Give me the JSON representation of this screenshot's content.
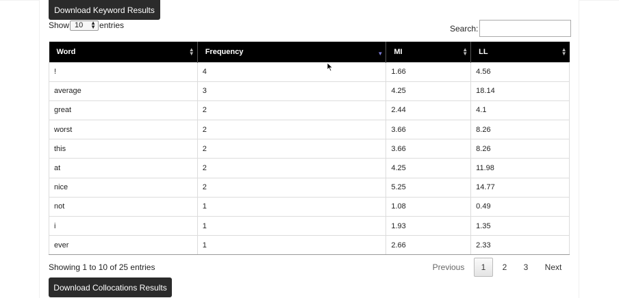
{
  "buttons": {
    "download_keyword": "Download Keyword Results",
    "download_collocations": "Download Collocations Results"
  },
  "length": {
    "show_label": "Show",
    "selected": "10",
    "entries_label": "entries"
  },
  "search": {
    "label": "Search:",
    "value": ""
  },
  "table": {
    "headers": [
      "Word",
      "Frequency",
      "MI",
      "LL"
    ],
    "sorted_column": "Frequency",
    "sort_direction": "descending",
    "rows": [
      [
        "!",
        "4",
        "1.66",
        "4.56"
      ],
      [
        "average",
        "3",
        "4.25",
        "18.14"
      ],
      [
        "great",
        "2",
        "2.44",
        "4.1"
      ],
      [
        "worst",
        "2",
        "3.66",
        "8.26"
      ],
      [
        "this",
        "2",
        "3.66",
        "8.26"
      ],
      [
        "at",
        "2",
        "4.25",
        "11.98"
      ],
      [
        "nice",
        "2",
        "5.25",
        "14.77"
      ],
      [
        "not",
        "1",
        "1.08",
        "0.49"
      ],
      [
        "i",
        "1",
        "1.93",
        "1.35"
      ],
      [
        "ever",
        "1",
        "2.66",
        "2.33"
      ]
    ]
  },
  "info": "Showing 1 to 10 of 25 entries",
  "pagination": {
    "previous": "Previous",
    "pages": [
      "1",
      "2",
      "3"
    ],
    "current": "1",
    "next": "Next"
  },
  "colors": {
    "header_bg": "#000000",
    "button_bg": "#2b2b2b",
    "sort_active": "#7b7bd6"
  }
}
